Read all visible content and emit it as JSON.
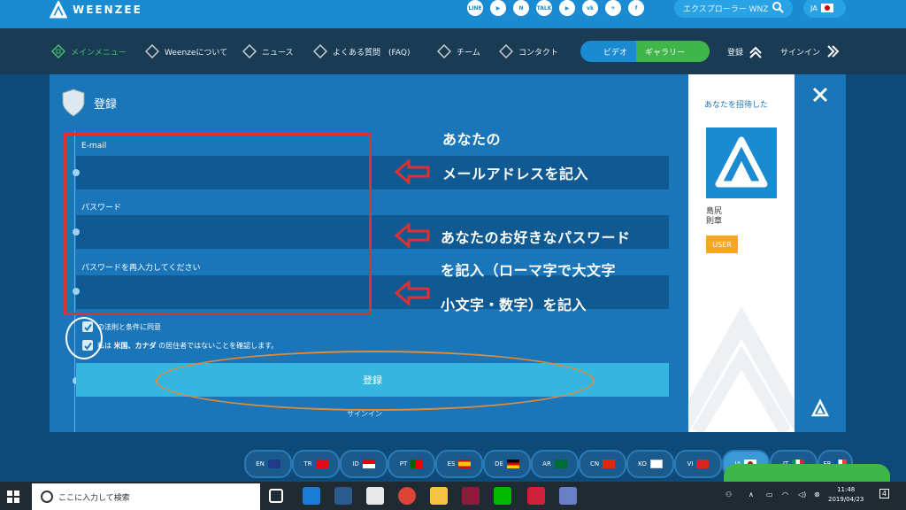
{
  "header": {
    "brand": "WEENZEE",
    "social_icons": [
      "LINE",
      "▶",
      "N",
      "TALK",
      "▶",
      "vk",
      "✈",
      "f"
    ],
    "search_placeholder": "エクスプローラー WNZ",
    "lang": "JA"
  },
  "nav": {
    "items": [
      "メインメニュー",
      "Weenzeについて",
      "ニュース",
      "よくある質問　(FAQ)",
      "チーム",
      "コンタクト"
    ],
    "video_label": "ビデオ",
    "gallery_label": "ギャラリー",
    "register_label": "登録",
    "signin_label": "サインイン"
  },
  "form": {
    "title": "登録",
    "email_label": "E-mail",
    "password_label": "パスワード",
    "password_confirm_label": "パスワードを再入力してください",
    "agree_terms": "の法則と条件に同意",
    "confirm_residence_prefix": "私は",
    "confirm_residence_bold": "米国、カナダ",
    "confirm_residence_suffix": "の居住者ではないことを確認します。",
    "submit_label": "登録",
    "signin_link": "サインイン"
  },
  "annotations": {
    "line1": "あなたの",
    "line2": "メールアドレスを記入",
    "line3": "あなたのお好きなパスワード",
    "line4": "を記入（ローマ字で大文字",
    "line5": "小文字・数字）を記入"
  },
  "sidebar": {
    "invited_by": "あなたを招待した",
    "inviter_name_line1": "島尻",
    "inviter_name_line2": "則章",
    "badge": "USER"
  },
  "languages": [
    "EN",
    "TR",
    "ID",
    "PT",
    "ES",
    "DE",
    "AR",
    "CN",
    "KO",
    "VI",
    "JA",
    "IT",
    "FR"
  ],
  "taskbar": {
    "search_placeholder": "ここに入力して検索",
    "time": "11:48",
    "date": "2019/04/23",
    "notification_count": "4"
  },
  "colors": {
    "topbar": "#1a8bd0",
    "navbar": "#1a3b54",
    "panel": "#1a76b8",
    "accent_green": "#40b54a",
    "annotation_red": "#e03030",
    "annotation_orange": "#e08a3a"
  }
}
